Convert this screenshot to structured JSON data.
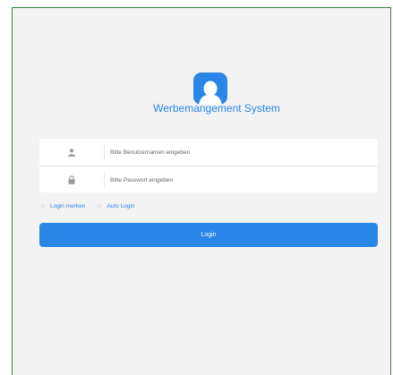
{
  "app": {
    "title": "Werbemangement System",
    "accent_color": "#2a86e6"
  },
  "form": {
    "username": {
      "icon": "user-icon",
      "placeholder": "Bitte Benutzernamen eingeben",
      "value": ""
    },
    "password": {
      "icon": "lock-icon",
      "placeholder": "Bitte Passwort eingeben",
      "value": ""
    },
    "options": {
      "remember_label": "Login merken",
      "auto_login_label": "Auto Login"
    },
    "submit_label": "Login"
  }
}
